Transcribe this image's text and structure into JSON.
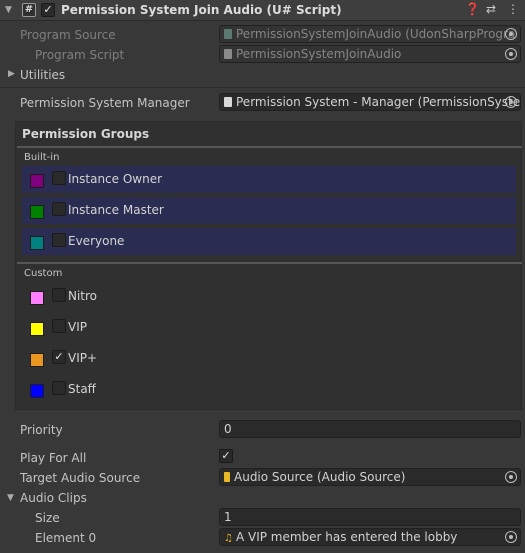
{
  "header": {
    "title": "Permission System Join Audio (U# Script)",
    "enabled": true,
    "icons": [
      "help-icon",
      "preset-icon",
      "menu-icon"
    ]
  },
  "program_source": {
    "label": "Program Source",
    "value": "PermissionSystemJoinAudio (UdonSharpProgra"
  },
  "program_script": {
    "label": "Program Script",
    "value": "PermissionSystemJoinAudio"
  },
  "utilities": {
    "label": "Utilities"
  },
  "manager": {
    "label": "Permission System Manager",
    "value": "Permission System - Manager (PermissionSyste"
  },
  "permission_groups": {
    "title": "Permission Groups",
    "builtin_label": "Built-in",
    "builtin": [
      {
        "name": "Instance Owner",
        "color": "#800080",
        "checked": false
      },
      {
        "name": "Instance Master",
        "color": "#008000",
        "checked": false
      },
      {
        "name": "Everyone",
        "color": "#008080",
        "checked": false
      }
    ],
    "custom_label": "Custom",
    "custom": [
      {
        "name": "Nitro",
        "color": "#ff80ff",
        "checked": false
      },
      {
        "name": "VIP",
        "color": "#ffff00",
        "checked": false
      },
      {
        "name": "VIP+",
        "color": "#e8961e",
        "checked": true
      },
      {
        "name": "Staff",
        "color": "#0000ff",
        "checked": false
      }
    ]
  },
  "priority": {
    "label": "Priority",
    "value": "0"
  },
  "play_for_all": {
    "label": "Play For All",
    "checked": true
  },
  "target_audio_source": {
    "label": "Target Audio Source",
    "value": "Audio Source (Audio Source)"
  },
  "audio_clips": {
    "label": "Audio Clips",
    "size_label": "Size",
    "size_value": "1",
    "element0_label": "Element 0",
    "element0_value": "A VIP member has entered the lobby"
  },
  "colors": {
    "background": "#383838",
    "builtin_row": "#2b2c52",
    "field": "#2a2a2a"
  }
}
